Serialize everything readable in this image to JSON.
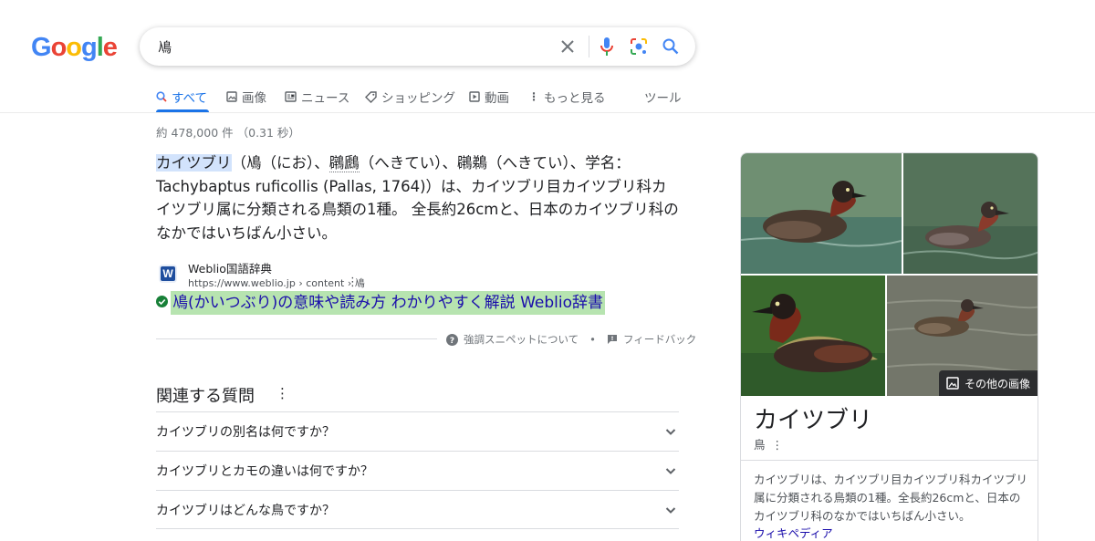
{
  "logo": {
    "letters": [
      "G",
      "o",
      "o",
      "g",
      "l",
      "e"
    ],
    "colors": [
      "#4285f4",
      "#ea4335",
      "#fbbc05",
      "#4285f4",
      "#34a853",
      "#ea4335"
    ]
  },
  "search": {
    "query": "鳰"
  },
  "tabs": [
    {
      "label": "すべて",
      "icon": "search-icon",
      "active": true
    },
    {
      "label": "画像",
      "icon": "image-icon"
    },
    {
      "label": "ニュース",
      "icon": "news-icon"
    },
    {
      "label": "ショッピング",
      "icon": "tag-icon"
    },
    {
      "label": "動画",
      "icon": "play-icon"
    },
    {
      "label": "もっと見る",
      "icon": "more-vert-icon"
    }
  ],
  "tools_label": "ツール",
  "result_stats": "約 478,000 件 （0.31 秒）",
  "snippet": {
    "highlight": "カイツブリ",
    "part1": "（鳰（にお）、",
    "dotted": "鸊鷉",
    "part2": "（へきてい）、鸊鵜（へきてい）、学名：Tachybaptus ruficollis (Pallas, 1764)）は、カイツブリ目カイツブリ科カイツブリ属に分類される鳥類の1種。 全長約26cmと、日本のカイツブリ科のなかではいちばん小さい。"
  },
  "source": {
    "favicon": "W",
    "name": "Weblio国語辞典",
    "url": "https://www.weblio.jp › content › 鳰"
  },
  "result_link": "鳰(かいつぶり)の意味や読み方 わかりやすく解説 Weblio辞書",
  "feedback": {
    "about": "強調スニペットについて",
    "sep": "•",
    "feedback": "フィードバック"
  },
  "paa": {
    "title": "関連する質問",
    "questions": [
      "カイツブリの別名は何ですか？",
      "カイツブリとカモの違いは何ですか？",
      "カイツブリはどんな鳥ですか？"
    ]
  },
  "knowledge_panel": {
    "more_images": "その他の画像",
    "title": "カイツブリ",
    "subtitle": "鳥",
    "description": "カイツブリは、カイツブリ目カイツブリ科カイツブリ属に分類される鳥類の1種。全長約26cmと、日本のカイツブリ科のなかではいちばん小さい。",
    "link": "ウィキペディア"
  },
  "colors": {
    "accent": "#1a73e8",
    "link": "#1a0dab",
    "highlight_green": "#b7e4b0"
  }
}
